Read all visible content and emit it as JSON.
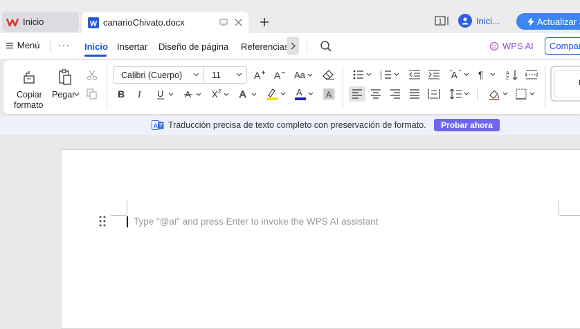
{
  "titlebar": {
    "home_tab": "Inicio",
    "doc_tab": "canarioChivato.docx",
    "user_label": "Inici...",
    "upgrade_label": "Actualizar a"
  },
  "menubar": {
    "menu_label": "Menú",
    "tabs": [
      "Inicio",
      "Insertar",
      "Diseño de página",
      "Referencias"
    ],
    "active_tab": "Inicio",
    "wps_ai_label": "WPS AI",
    "share_label": "Compart"
  },
  "ribbon": {
    "copy_format_label_1": "Copiar",
    "copy_format_label_2": "formato",
    "paste_label": "Pegar",
    "font_name": "Calibri (Cuerpo)",
    "font_size": "11",
    "style_preview": "I"
  },
  "banner": {
    "text": "Traducción precisa de texto completo con preservación de formato.",
    "button_label": "Probar ahora"
  },
  "document": {
    "placeholder": "Type \"@ai\" and press Enter to invoke the WPS AI assistant"
  },
  "colors": {
    "accent": "#1a56d6",
    "upgrade_button": "#3d86f2",
    "try_button": "#7067ec",
    "wps_ai": "#8a4be0",
    "highlight": "#f5e100",
    "font_color": "#1522c9",
    "logo_red": "#e0332b",
    "word_blue": "#2a59d8"
  }
}
